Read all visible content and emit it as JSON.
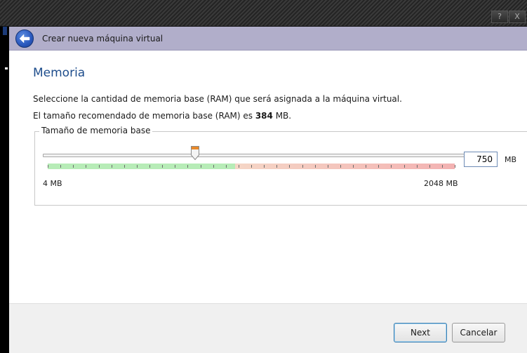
{
  "window": {
    "title_buttons": [
      "?",
      "X"
    ]
  },
  "header": {
    "title": "Crear nueva máquina virtual"
  },
  "page": {
    "title": "Memoria",
    "description": "Seleccione la cantidad de memoria base (RAM) que será asignada a la máquina virtual.",
    "recommended_prefix": "El tamaño recomendado de memoria base (RAM) es ",
    "recommended_value": "384",
    "recommended_suffix": " MB."
  },
  "memory": {
    "group_label": "Tamaño de memoria base",
    "value": "750",
    "value_num": 750,
    "unit": "MB",
    "min_label": "4 MB",
    "max_label": "2048 MB",
    "min": 4,
    "max": 2048,
    "recommended_fraction_green": 0.46
  },
  "footer": {
    "next_label": "Next",
    "cancel_label": "Cancelar"
  },
  "colors": {
    "header_bg": "#b1aeca",
    "title_blue": "#1e4d8c",
    "slider_green": "#b7ecb7",
    "slider_red": "#f3b2b2",
    "handle_orange": "#e8892a"
  },
  "icons": {
    "back": "back-arrow-icon",
    "help": "help-icon",
    "close": "close-icon"
  }
}
